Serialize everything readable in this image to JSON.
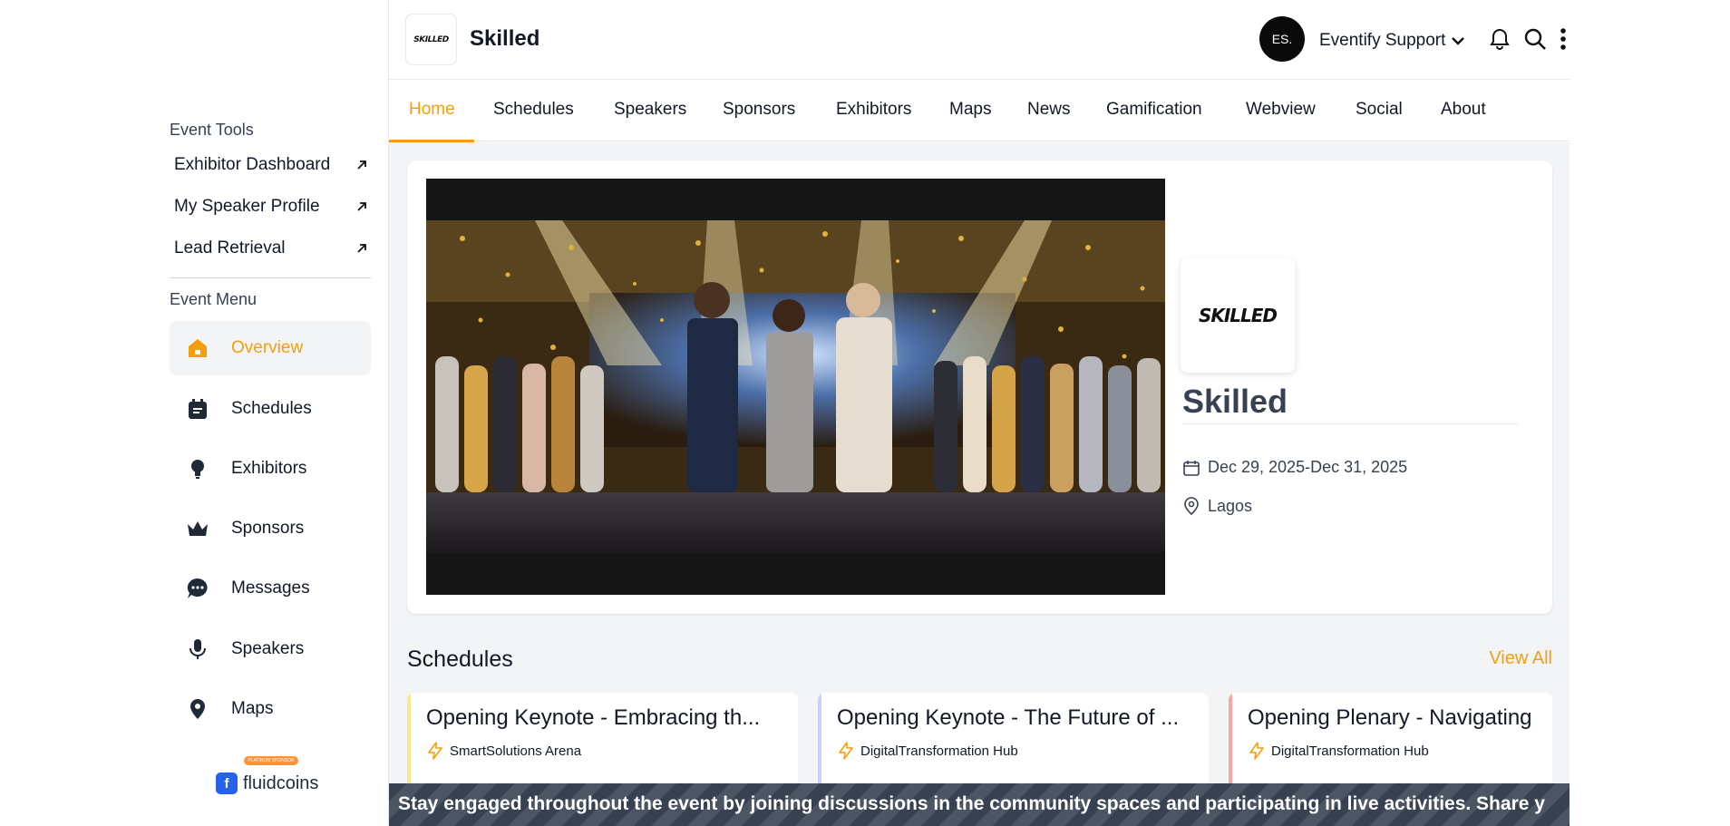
{
  "sidebar": {
    "event_tools_heading": "Event Tools",
    "tools": [
      {
        "label": "Exhibitor Dashboard",
        "icon": "external-link-icon"
      },
      {
        "label": "My Speaker Profile",
        "icon": "external-link-icon"
      },
      {
        "label": "Lead Retrieval",
        "icon": "external-link-icon"
      }
    ],
    "event_menu_heading": "Event Menu",
    "menu": [
      {
        "label": "Overview",
        "icon": "home-icon",
        "active": true
      },
      {
        "label": "Schedules",
        "icon": "calendar-icon"
      },
      {
        "label": "Exhibitors",
        "icon": "lightbulb-icon"
      },
      {
        "label": "Sponsors",
        "icon": "crown-icon"
      },
      {
        "label": "Messages",
        "icon": "chat-icon"
      },
      {
        "label": "Speakers",
        "icon": "microphone-icon"
      },
      {
        "label": "Maps",
        "icon": "map-pin-icon"
      }
    ],
    "sponsor": {
      "badge": "PLATINUM SPONSOR",
      "name": "fluidcoins",
      "icon_letter": "f"
    }
  },
  "header": {
    "logo_text": "SKILLED",
    "brand_name": "Skilled",
    "avatar_initials": "ES.",
    "user_name": "Eventify Support"
  },
  "nav": {
    "tabs": [
      "Home",
      "Schedules",
      "Speakers",
      "Sponsors",
      "Exhibitors",
      "Maps",
      "News",
      "Gamification",
      "Webview",
      "Social",
      "About"
    ],
    "active": "Home"
  },
  "event": {
    "logo_text": "SKILLED",
    "title": "Skilled",
    "dates": "Dec 29, 2025-Dec 31, 2025",
    "location": "Lagos"
  },
  "schedules": {
    "heading": "Schedules",
    "view_all": "View All",
    "items": [
      {
        "title": "Opening Keynote - Embracing th...",
        "venue": "SmartSolutions Arena",
        "accent": "#fde68a"
      },
      {
        "title": "Opening Keynote - The Future of ...",
        "venue": "DigitalTransformation Hub",
        "accent": "#c7d2fe"
      },
      {
        "title": "Opening Plenary - Navigating",
        "venue": "DigitalTransformation Hub",
        "accent": "#fca5a5"
      }
    ]
  },
  "ticker": {
    "text": "Stay engaged throughout the event by joining discussions in the community spaces and participating in live activities. Share y"
  },
  "colors": {
    "accent": "#f59e0b",
    "sidebar_active_bg": "#f3f4f6",
    "main_bg": "#f3f4f6"
  }
}
